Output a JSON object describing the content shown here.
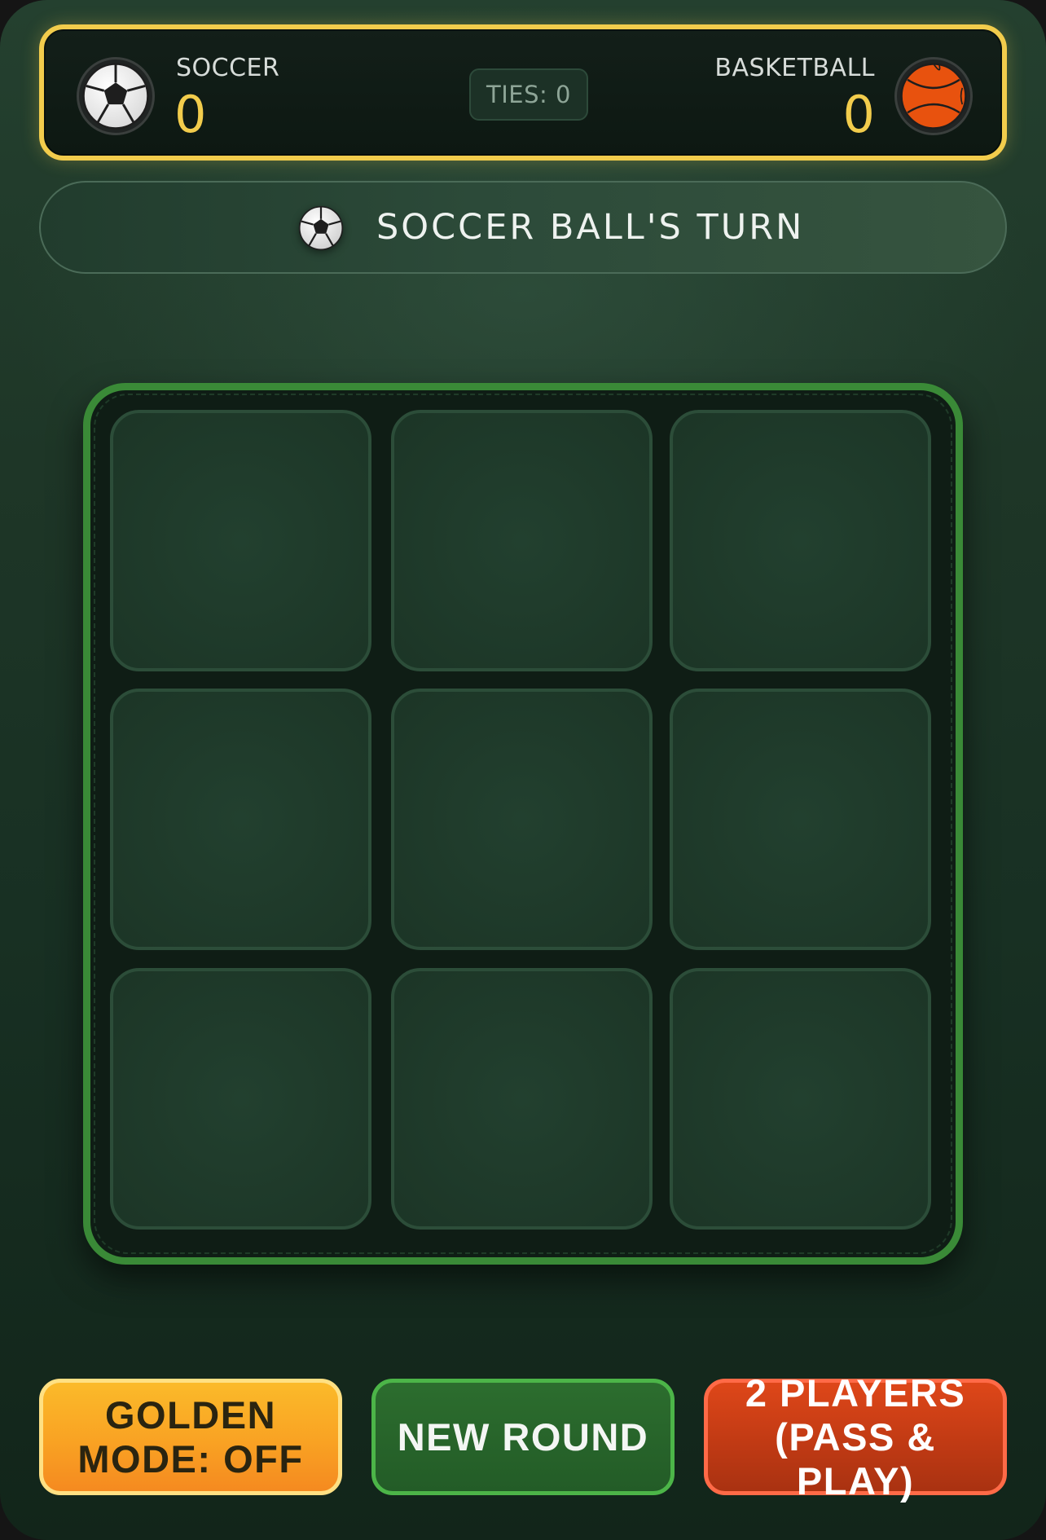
{
  "scoreboard": {
    "player1": {
      "label": "SOCCER",
      "score": "0",
      "icon": "soccer-ball-icon"
    },
    "player2": {
      "label": "BASKETBALL",
      "score": "0",
      "icon": "basketball-icon"
    },
    "ties": "TIES: 0"
  },
  "turn": {
    "text": "SOCCER BALL'S TURN",
    "icon": "soccer-ball-icon"
  },
  "board": {
    "cells": [
      "",
      "",
      "",
      "",
      "",
      "",
      "",
      "",
      ""
    ]
  },
  "buttons": {
    "golden_mode": "GOLDEN\nMODE: OFF",
    "new_round": "NEW ROUND",
    "players": "2 PLAYERS\n(PASS &\nPLAY)"
  },
  "colors": {
    "accent_gold": "#f2cc4c",
    "board_border": "#3a8a37",
    "golden_button": "#f9a223",
    "new_round_button": "#235c27",
    "players_button": "#c13a14"
  }
}
